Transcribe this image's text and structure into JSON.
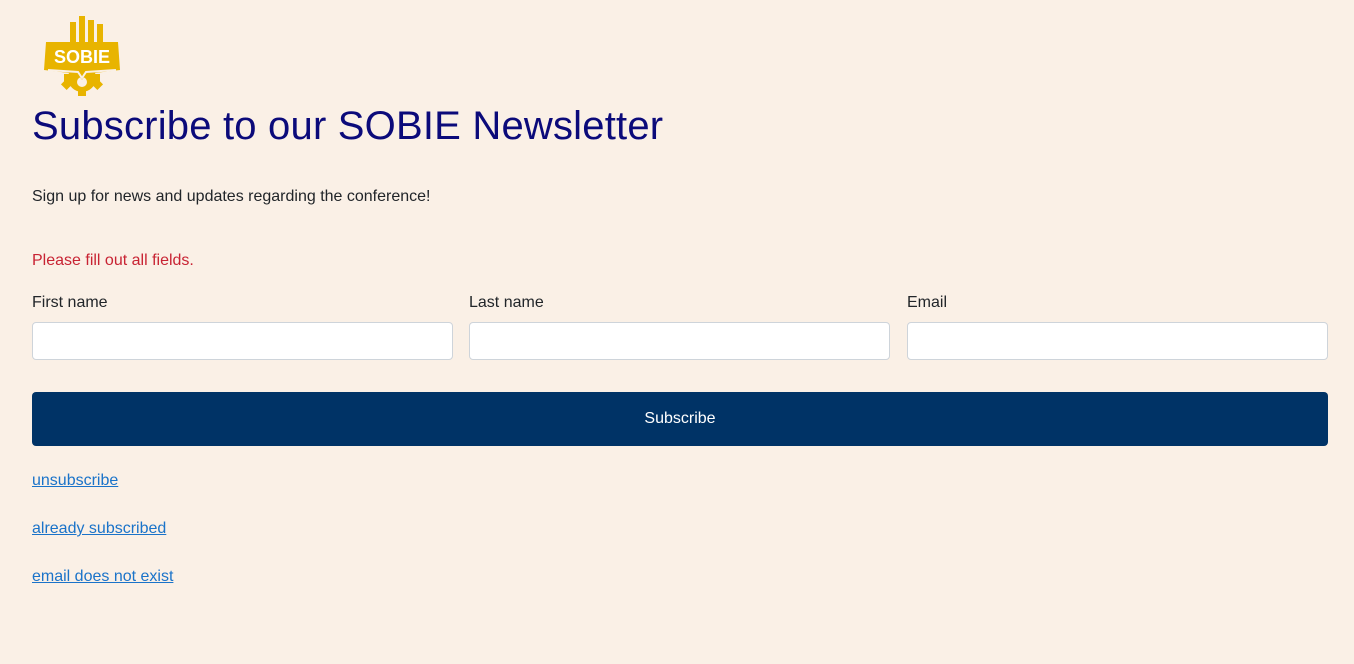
{
  "logo": {
    "text": "SOBIE",
    "color": "#e8b400"
  },
  "header": {
    "title": "Subscribe to our SOBIE Newsletter",
    "subtitle": "Sign up for news and updates regarding the conference!"
  },
  "form": {
    "error": "Please fill out all fields.",
    "first_name": {
      "label": "First name",
      "value": ""
    },
    "last_name": {
      "label": "Last name",
      "value": ""
    },
    "email": {
      "label": "Email",
      "value": ""
    },
    "submit_label": "Subscribe"
  },
  "links": {
    "unsubscribe": "unsubscribe",
    "already_subscribed": "already subscribed",
    "email_not_exist": "email does not exist"
  },
  "colors": {
    "background": "#faf0e6",
    "title": "#0b0a7a",
    "button": "#003366",
    "error": "#c82333",
    "link": "#1a73c9"
  }
}
